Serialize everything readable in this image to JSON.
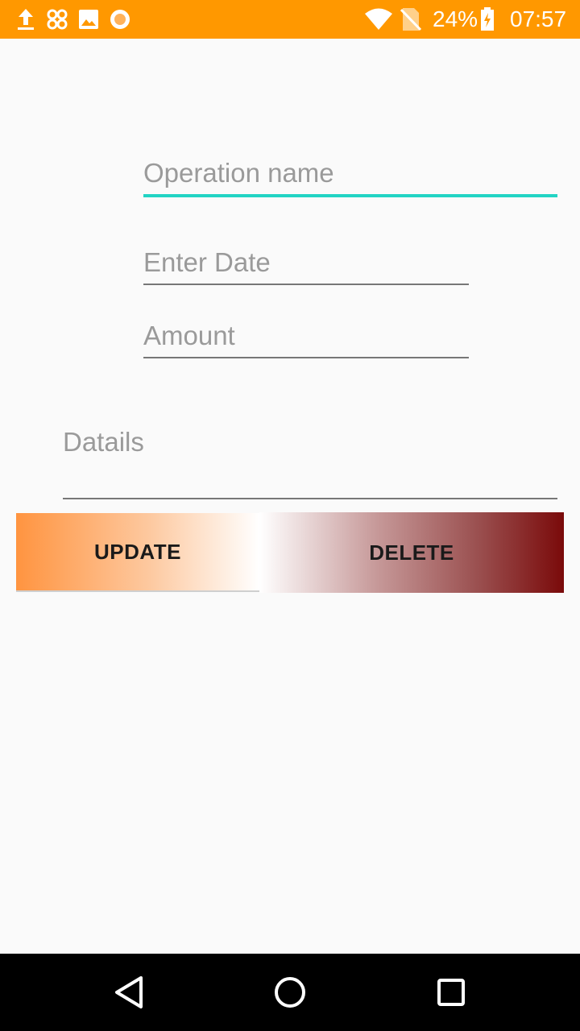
{
  "status_bar": {
    "battery": "24%",
    "time": "07:57",
    "left_icons": [
      "upload-icon",
      "pinwheel-icon",
      "image-icon",
      "circle-notification-icon"
    ],
    "right_icons": [
      "wifi-icon",
      "no-sim-icon",
      "battery-charging-icon"
    ],
    "color": "#ff9800"
  },
  "form": {
    "operation_name_placeholder": "Operation name",
    "date_placeholder": "Enter Date",
    "amount_placeholder": "Amount",
    "details_placeholder": "Datails",
    "focus_color": "#22d4c4"
  },
  "buttons": {
    "update_label": "UPDATE",
    "delete_label": "DELETE"
  },
  "nav_bar": {
    "icons": [
      "back-icon",
      "home-icon",
      "recents-icon"
    ]
  }
}
